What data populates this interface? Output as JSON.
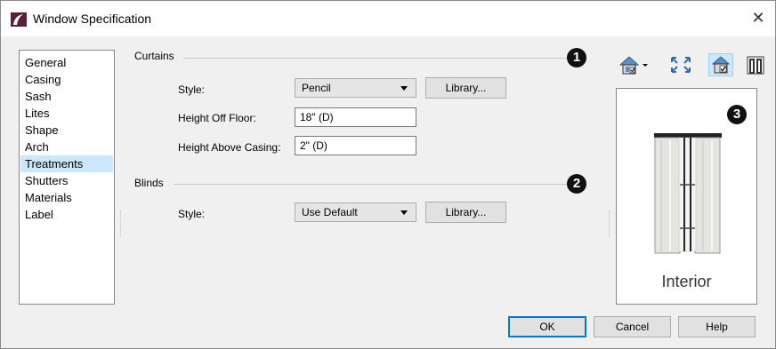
{
  "title": "Window Specification",
  "close_glyph": "✕",
  "sidebar": {
    "items": [
      {
        "label": "General"
      },
      {
        "label": "Casing"
      },
      {
        "label": "Sash"
      },
      {
        "label": "Lites"
      },
      {
        "label": "Shape"
      },
      {
        "label": "Arch"
      },
      {
        "label": "Treatments",
        "selected": true
      },
      {
        "label": "Shutters"
      },
      {
        "label": "Materials"
      },
      {
        "label": "Label"
      }
    ]
  },
  "curtains": {
    "group_label": "Curtains",
    "callout": "1",
    "style_label": "Style:",
    "style_value": "Pencil",
    "library_label": "Library...",
    "height_off_floor_label": "Height Off Floor:",
    "height_off_floor_value": "18\" (D)",
    "height_above_casing_label": "Height Above Casing:",
    "height_above_casing_value": "2\" (D)"
  },
  "blinds": {
    "group_label": "Blinds",
    "callout": "2",
    "style_label": "Style:",
    "style_value": "Use Default",
    "library_label": "Library..."
  },
  "preview": {
    "callout": "3",
    "caption": "Interior"
  },
  "toolbar": {
    "icons": [
      "view-type-icon",
      "fill-window-icon",
      "interior-view-icon",
      "exterior-view-icon"
    ]
  },
  "footer": {
    "ok_label": "OK",
    "cancel_label": "Cancel",
    "help_label": "Help"
  },
  "colors": {
    "selection": "#cce8ff",
    "title_icon": "#5a1f3c",
    "accent": "#0078d7"
  }
}
